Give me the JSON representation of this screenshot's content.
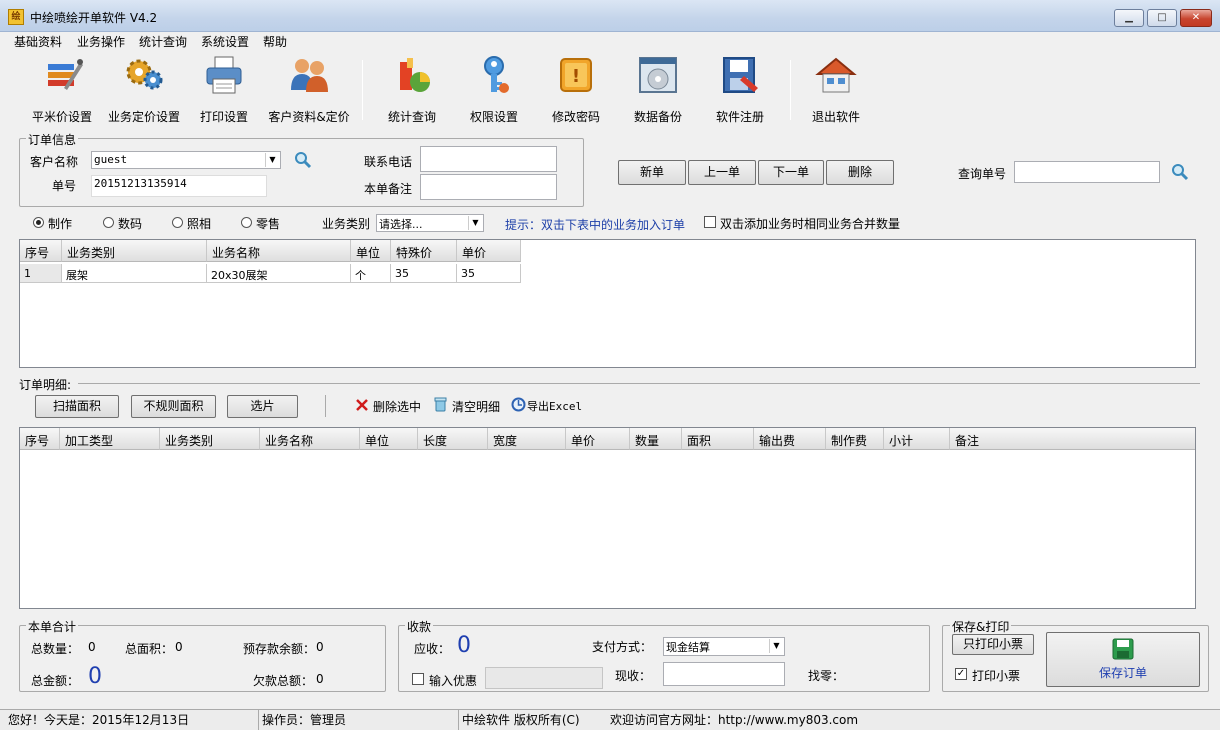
{
  "window": {
    "title": "中绘喷绘开单软件 V4.2",
    "min_glyph": "▁",
    "max_glyph": "□",
    "close_glyph": "✕"
  },
  "menu": [
    "基础资料",
    "业务操作",
    "统计查询",
    "系统设置",
    "帮助"
  ],
  "toolbar": [
    {
      "label": "平米价设置",
      "icon": "tools-icon"
    },
    {
      "label": "业务定价设置",
      "icon": "gears-icon"
    },
    {
      "label": "打印设置",
      "icon": "printer-icon"
    },
    {
      "label": "客户资料&定价",
      "icon": "users-icon"
    },
    {
      "label": "统计查询",
      "icon": "stats-icon"
    },
    {
      "label": "权限设置",
      "icon": "key-icon"
    },
    {
      "label": "修改密码",
      "icon": "password-icon"
    },
    {
      "label": "数据备份",
      "icon": "backup-icon"
    },
    {
      "label": "软件注册",
      "icon": "register-icon"
    },
    {
      "label": "退出软件",
      "icon": "house-exit-icon"
    }
  ],
  "order_info": {
    "group_title": "订单信息",
    "customer_label": "客户名称",
    "customer_value": "guest",
    "order_no_label": "单号",
    "order_no_value": "20151213135914",
    "phone_label": "联系电话",
    "phone_value": "",
    "remark_label": "本单备注",
    "remark_value": ""
  },
  "nav_buttons": {
    "new": "新单",
    "prev": "上一单",
    "next": "下一单",
    "delete": "删除"
  },
  "query": {
    "label": "查询单号",
    "value": ""
  },
  "filters": {
    "radios": [
      {
        "label": "制作",
        "checked": true
      },
      {
        "label": "数码",
        "checked": false
      },
      {
        "label": "照相",
        "checked": false
      },
      {
        "label": "零售",
        "checked": false
      }
    ],
    "category_label": "业务类别",
    "category_value": "请选择...",
    "hint": "提示：双击下表中的业务加入订单",
    "merge_label": "双击添加业务时相同业务合并数量"
  },
  "business_table": {
    "headers": [
      "序号",
      "业务类别",
      "业务名称",
      "单位",
      "特殊价",
      "单价"
    ],
    "rows": [
      [
        "1",
        "展架",
        "20x30展架",
        "个",
        "35",
        "35"
      ]
    ]
  },
  "detail": {
    "section_label": "订单明细:",
    "buttons": {
      "scan": "扫描面积",
      "irregular": "不规则面积",
      "select": "选片"
    },
    "actions": {
      "delete_selected": "删除选中",
      "clear": "清空明细",
      "export": "导出Excel"
    },
    "headers": [
      "序号",
      "加工类型",
      "业务类别",
      "业务名称",
      "单位",
      "长度",
      "宽度",
      "单价",
      "数量",
      "面积",
      "输出费",
      "制作费",
      "小计",
      "备注"
    ]
  },
  "totals": {
    "group_title": "本单合计",
    "qty_label": "总数量：",
    "qty_value": "0",
    "area_label": "总面积：",
    "area_value": "0",
    "prepaid_label": "预存款余额：",
    "prepaid_value": "0",
    "amount_label": "总金额：",
    "amount_value": "0",
    "owed_label": "欠款总额：",
    "owed_value": "0"
  },
  "payment": {
    "group_title": "收款",
    "due_label": "应收：",
    "due_value": "0",
    "method_label": "支付方式：",
    "method_value": "现金结算",
    "discount_label": "输入优惠",
    "received_label": "现收：",
    "change_label": "找零："
  },
  "save_print": {
    "group_title": "保存&打印",
    "print_only": "只打印小票",
    "print_receipt_label": "打印小票",
    "save_order": "保存订单"
  },
  "status": {
    "greeting": "您好！今天是：2015年12月13日",
    "operator": "操作员：管理员",
    "copyright": "中绘软件 版权所有(C)",
    "website": "欢迎访问官方网址：http://www.my803.com"
  }
}
